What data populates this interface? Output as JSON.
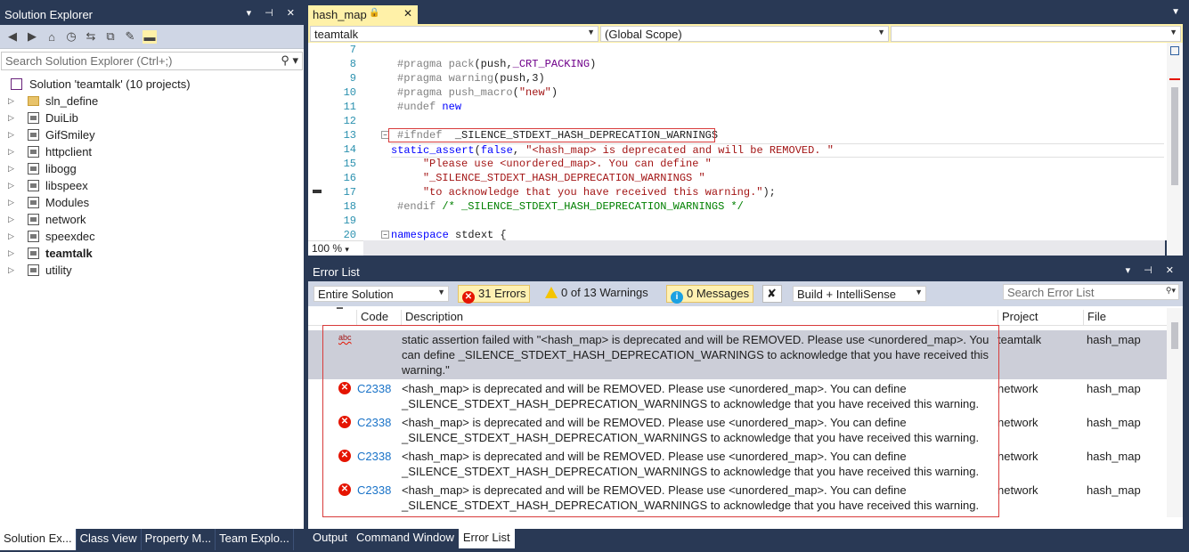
{
  "solution_explorer": {
    "title": "Solution Explorer",
    "search_placeholder": "Search Solution Explorer (Ctrl+;)",
    "solution_label": "Solution 'teamtalk' (10 projects)",
    "items": [
      {
        "label": "sln_define",
        "kind": "folder"
      },
      {
        "label": "DuiLib",
        "kind": "project"
      },
      {
        "label": "GifSmiley",
        "kind": "project"
      },
      {
        "label": "httpclient",
        "kind": "project"
      },
      {
        "label": "libogg",
        "kind": "project"
      },
      {
        "label": "libspeex",
        "kind": "project"
      },
      {
        "label": "Modules",
        "kind": "project"
      },
      {
        "label": "network",
        "kind": "project"
      },
      {
        "label": "speexdec",
        "kind": "project"
      },
      {
        "label": "teamtalk",
        "kind": "project",
        "bold": true
      },
      {
        "label": "utility",
        "kind": "project"
      }
    ],
    "bottom_tabs": [
      "Solution Ex...",
      "Class View",
      "Property M...",
      "Team Explo..."
    ]
  },
  "editor": {
    "tab_label": "hash_map",
    "nav_project": "teamtalk",
    "nav_scope": "(Global Scope)",
    "zoom": "100 %",
    "lines": [
      {
        "n": "7",
        "html": ""
      },
      {
        "n": "8",
        "html": "<span class='pp'>#pragma</span> <span class='pp'>pack</span>(push,<span class='mc'>_CRT_PACKING</span>)"
      },
      {
        "n": "9",
        "html": "<span class='pp'>#pragma</span> <span class='pp'>warning</span>(push,3)"
      },
      {
        "n": "10",
        "html": "<span class='pp'>#pragma</span> <span class='pp'>push_macro</span>(<span class='st'>\"new\"</span>)"
      },
      {
        "n": "11",
        "html": "<span class='pp'>#undef</span> <span class='kw'>new</span>"
      },
      {
        "n": "12",
        "html": ""
      },
      {
        "n": "13",
        "html": "<span class='pp'>#ifndef</span>  _SILENCE_STDEXT_HASH_DEPRECATION_WARNINGS"
      },
      {
        "n": "14",
        "html": "<span class='kw'>static_assert</span>(<span class='kw'>false</span>, <span class='st'>\"&lt;hash_map&gt; is deprecated and will be REMOVED. \"</span>"
      },
      {
        "n": "15",
        "html": "    <span class='st'>\"Please use &lt;unordered_map&gt;. You can define \"</span>"
      },
      {
        "n": "16",
        "html": "    <span class='st'>\"_SILENCE_STDEXT_HASH_DEPRECATION_WARNINGS \"</span>"
      },
      {
        "n": "17",
        "html": "    <span class='st'>\"to acknowledge that you have received this warning.\"</span>);"
      },
      {
        "n": "18",
        "html": "<span class='pp'>#endif</span> <span class='cm'>/* _SILENCE_STDEXT_HASH_DEPRECATION_WARNINGS */</span>"
      },
      {
        "n": "19",
        "html": ""
      },
      {
        "n": "20",
        "html": "<span class='kw'>namespace</span> stdext {"
      }
    ]
  },
  "error_list": {
    "title": "Error List",
    "scope": "Entire Solution",
    "errors_label": "31 Errors",
    "warnings_label": "0 of 13 Warnings",
    "messages_label": "0 Messages",
    "build_filter": "Build + IntelliSense",
    "search_placeholder": "Search Error List",
    "columns": {
      "code": "Code",
      "description": "Description",
      "project": "Project",
      "file": "File"
    },
    "rows": [
      {
        "icon": "intellisense",
        "code": "",
        "description": "static assertion failed with \"<hash_map> is deprecated and will be REMOVED. Please use <unordered_map>. You can define _SILENCE_STDEXT_HASH_DEPRECATION_WARNINGS to acknowledge that you have received this warning.\"",
        "project": "teamtalk",
        "file": "hash_map"
      },
      {
        "icon": "error",
        "code": "C2338",
        "description": "<hash_map> is deprecated and will be REMOVED. Please use <unordered_map>. You can define _SILENCE_STDEXT_HASH_DEPRECATION_WARNINGS to acknowledge that you have received this warning.",
        "project": "network",
        "file": "hash_map"
      },
      {
        "icon": "error",
        "code": "C2338",
        "description": "<hash_map> is deprecated and will be REMOVED. Please use <unordered_map>. You can define _SILENCE_STDEXT_HASH_DEPRECATION_WARNINGS to acknowledge that you have received this warning.",
        "project": "network",
        "file": "hash_map"
      },
      {
        "icon": "error",
        "code": "C2338",
        "description": "<hash_map> is deprecated and will be REMOVED. Please use <unordered_map>. You can define _SILENCE_STDEXT_HASH_DEPRECATION_WARNINGS to acknowledge that you have received this warning.",
        "project": "network",
        "file": "hash_map"
      },
      {
        "icon": "error",
        "code": "C2338",
        "description": "<hash_map> is deprecated and will be REMOVED. Please use <unordered_map>. You can define _SILENCE_STDEXT_HASH_DEPRECATION_WARNINGS to acknowledge that you have received this warning.",
        "project": "network",
        "file": "hash_map"
      }
    ],
    "bottom_tabs": [
      "Output",
      "Command Window",
      "Error List"
    ]
  },
  "colors": {
    "chrome": "#293955",
    "active_tab": "#fff1a8",
    "error": "#e51400",
    "highlight_box": "#d83b3b"
  }
}
